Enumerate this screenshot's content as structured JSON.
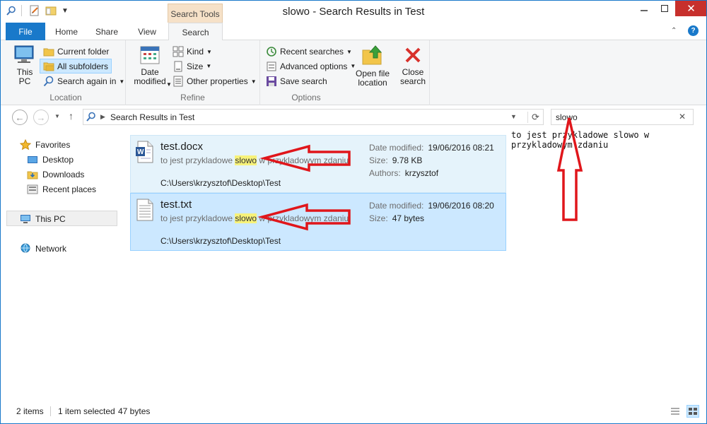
{
  "window": {
    "title": "slowo - Search Results in Test"
  },
  "contextual_group": "Search Tools",
  "tabs": [
    "File",
    "Home",
    "Share",
    "View",
    "Search"
  ],
  "ribbon": {
    "location": {
      "this_pc": "This\nPC",
      "current_folder": "Current folder",
      "all_subfolders": "All subfolders",
      "search_again_in": "Search again in",
      "label": "Location"
    },
    "refine": {
      "date_modified": "Date\nmodified",
      "kind": "Kind",
      "size": "Size",
      "other_properties": "Other properties",
      "label": "Refine"
    },
    "options": {
      "recent_searches": "Recent searches",
      "advanced_options": "Advanced options",
      "save_search": "Save search",
      "open_file_location": "Open file\nlocation",
      "close_search": "Close\nsearch",
      "label": "Options"
    }
  },
  "address": {
    "path": "Search Results in Test"
  },
  "search": {
    "value": "slowo"
  },
  "nav": {
    "favorites": "Favorites",
    "desktop": "Desktop",
    "downloads": "Downloads",
    "recent_places": "Recent places",
    "this_pc": "This PC",
    "network": "Network"
  },
  "results": [
    {
      "name": "test.docx",
      "snippet_pre": "to jest przykladowe ",
      "snippet_hit": "slowo",
      "snippet_post": " w przykladowym zdaniu",
      "path": "C:\\Users\\krzysztof\\Desktop\\Test",
      "date_label": "Date modified:",
      "date_value": "19/06/2016 08:21",
      "size_label": "Size:",
      "size_value": "9.78 KB",
      "authors_label": "Authors:",
      "authors_value": "krzysztof"
    },
    {
      "name": "test.txt",
      "snippet_pre": "to jest przykladowe ",
      "snippet_hit": "slowo",
      "snippet_post": " w przykladowym zdaniu",
      "path": "C:\\Users\\krzysztof\\Desktop\\Test",
      "date_label": "Date modified:",
      "date_value": "19/06/2016 08:20",
      "size_label": "Size:",
      "size_value": "47 bytes"
    }
  ],
  "preview_text": "to jest przykladowe slowo w\nprzykladowym zdaniu",
  "status": {
    "count": "2 items",
    "selected": "1 item selected",
    "size": "47 bytes"
  },
  "colors": {
    "accent": "#1979ca",
    "arrow": "#e0161b",
    "selection": "#cce8ff",
    "highlight": "#f7f27a"
  }
}
